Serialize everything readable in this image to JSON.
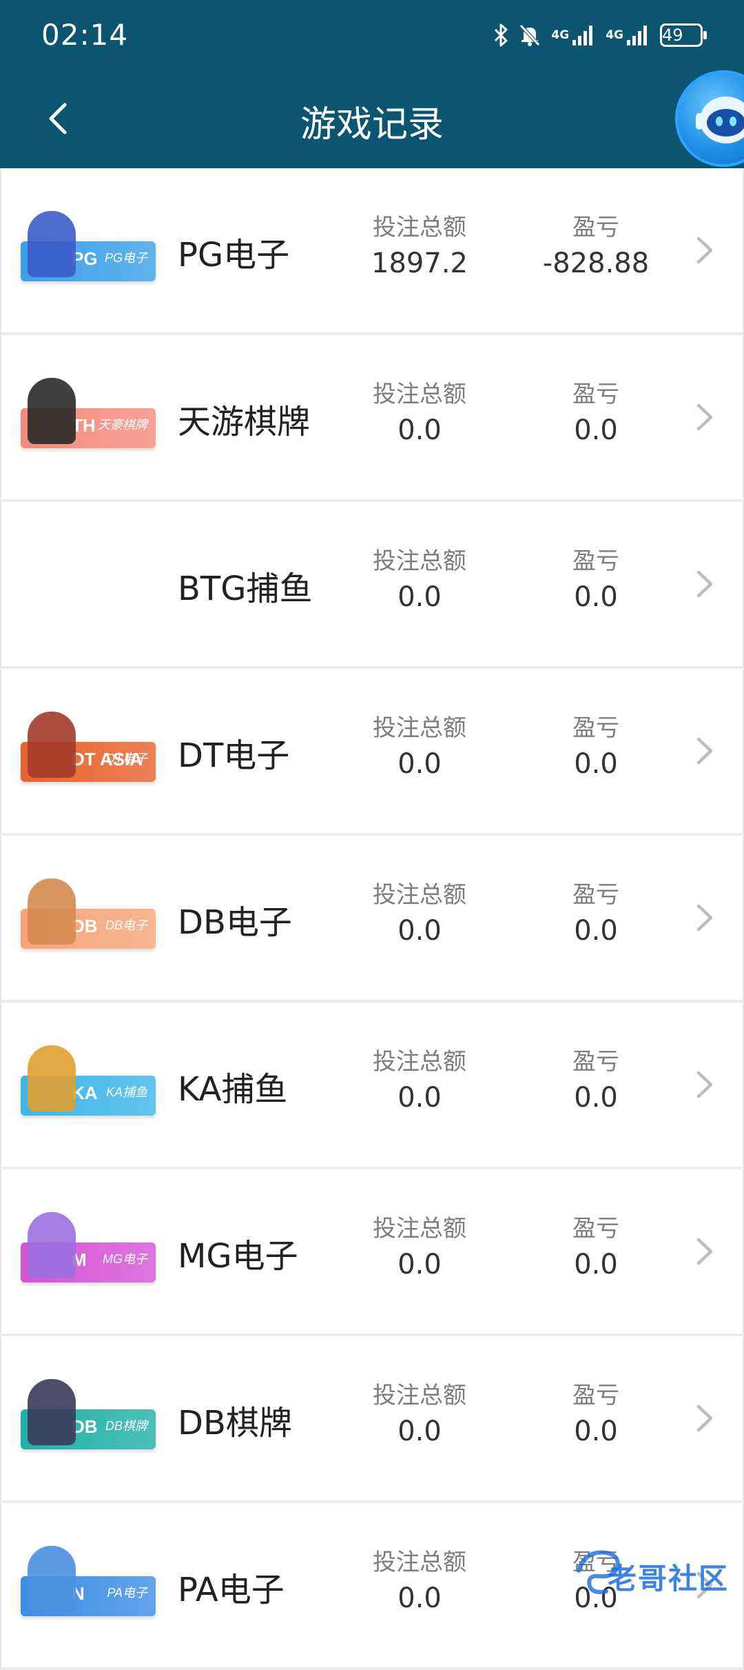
{
  "status_bar": {
    "time": "02:14",
    "network_1": "4G",
    "network_2": "4G",
    "battery": "49"
  },
  "header": {
    "title": "游戏记录"
  },
  "columns": {
    "bet_label": "投注总额",
    "profit_label": "盈亏"
  },
  "games": [
    {
      "name": "PG电子",
      "badge_text": "PG电子",
      "badge_logo": "PG",
      "badge_color": "#3aa0e8",
      "figure_color": "#3b5bc9",
      "bet": "1897.2",
      "profit": "-828.88"
    },
    {
      "name": "天游棋牌",
      "badge_text": "天豪棋牌",
      "badge_logo": "TH",
      "badge_color": "#f58a7c",
      "figure_color": "#2a2a2a",
      "bet": "0.0",
      "profit": "0.0"
    },
    {
      "name": "BTG捕鱼",
      "badge_text": "",
      "badge_logo": "",
      "badge_color": "",
      "figure_color": "",
      "bet": "0.0",
      "profit": "0.0"
    },
    {
      "name": "DT电子",
      "badge_text": "DT电子",
      "badge_logo": "DT ASIA",
      "badge_color": "#e8622c",
      "figure_color": "#a23a2a",
      "bet": "0.0",
      "profit": "0.0"
    },
    {
      "name": "DB电子",
      "badge_text": "DB电子",
      "badge_logo": "DB",
      "badge_color": "#f6a477",
      "figure_color": "#d58a4e",
      "bet": "0.0",
      "profit": "0.0"
    },
    {
      "name": "KA捕鱼",
      "badge_text": "KA捕鱼",
      "badge_logo": "KA",
      "badge_color": "#3db5ea",
      "figure_color": "#e0a030",
      "bet": "0.0",
      "profit": "0.0"
    },
    {
      "name": "MG电子",
      "badge_text": "MG电子",
      "badge_logo": "M",
      "badge_color": "#d653d6",
      "figure_color": "#9c6fe0",
      "bet": "0.0",
      "profit": "0.0"
    },
    {
      "name": "DB棋牌",
      "badge_text": "DB棋牌",
      "badge_logo": "DB",
      "badge_color": "#1fb0a8",
      "figure_color": "#3a3a5a",
      "bet": "0.0",
      "profit": "0.0"
    },
    {
      "name": "PA电子",
      "badge_text": "PA电子",
      "badge_logo": "N",
      "badge_color": "#3b8de6",
      "figure_color": "#4a90e0",
      "bet": "0.0",
      "profit": "0.0"
    }
  ],
  "watermark": {
    "text": "老哥社区"
  }
}
